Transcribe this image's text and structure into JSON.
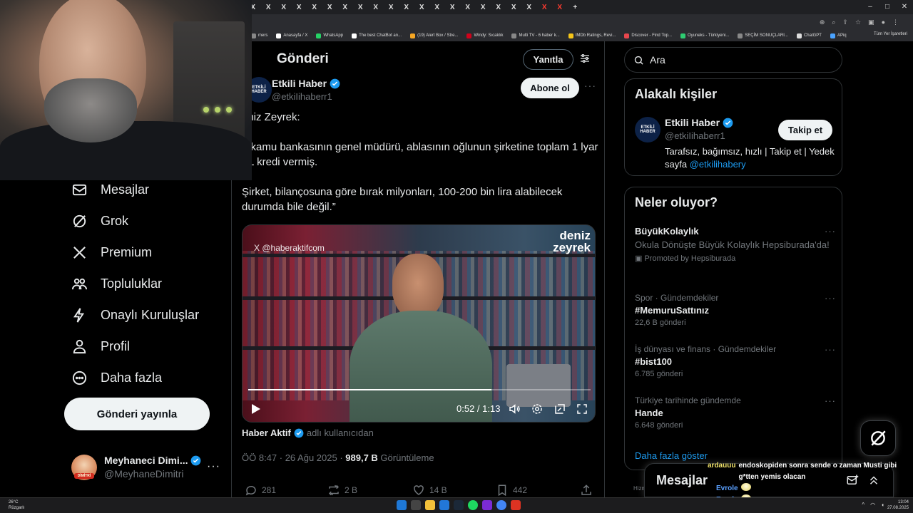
{
  "browser": {
    "bookmarks": [
      "mers",
      "Anasayfa / X",
      "WhatsApp",
      "The best ChatBot an...",
      "(19) Alert Box / Stre...",
      "Windy: Sıcaklık",
      "Multi TV - 6 haber k...",
      "IMDb Ratings, Revi...",
      "Discover - Find Top...",
      "Oyuneks - Türkiyeni...",
      "SEÇİM SONUÇLARI...",
      "ChatGPT",
      "APiq"
    ],
    "bookmarks_right": "Tüm Yer İşaretleri"
  },
  "nav": {
    "items": [
      {
        "label": "Mesajlar",
        "icon": "mail-icon"
      },
      {
        "label": "Grok",
        "icon": "grok-icon"
      },
      {
        "label": "Premium",
        "icon": "x-logo-icon"
      },
      {
        "label": "Topluluklar",
        "icon": "communities-icon"
      },
      {
        "label": "Onaylı Kuruluşlar",
        "icon": "lightning-icon"
      },
      {
        "label": "Profil",
        "icon": "person-icon"
      },
      {
        "label": "Daha fazla",
        "icon": "more-circle-icon"
      }
    ],
    "post_button": "Gönderi yayınla",
    "account": {
      "name": "Meyhaneci Dimi...",
      "handle": "@MeyhaneDimitri",
      "more": "···",
      "avatar_caption": "DİMİTRİ"
    }
  },
  "main": {
    "header_title": "Gönderi",
    "reply_button": "Yanıtla",
    "tweet": {
      "author_name": "Etkili Haber",
      "author_handle": "@etkiIihaberr1",
      "avatar_text": "ETKİLİ HABER",
      "follow_button": "Abone ol",
      "more": "···",
      "paragraphs": [
        "eniz Zeyrek:",
        "ir kamu bankasının genel müdürü, ablasının oğlunun şirketine toplam 1 lyar TL kredi vermiş.",
        "Şirket, bilançosuna göre bırak milyonları, 100-200 bin lira alabilecek durumda bile değil.”"
      ],
      "video": {
        "watermark": "X @haberaktifcom",
        "brand": "deniz zeyrek",
        "time": "0:52 / 1:13",
        "progress": 0.71
      },
      "source_name": "Haber Aktif",
      "source_suffix": "adlı kullanıcıdan",
      "timestamp": "ÖÖ 8:47 · 26 Ağu 2025 · ",
      "views": "989,7 B",
      "views_label": " Görüntüleme",
      "actions": {
        "replies": "281",
        "reposts": "2 B",
        "likes": "14 B",
        "bookmarks": "442"
      }
    }
  },
  "sidebar": {
    "search_placeholder": "Ara",
    "related": {
      "title": "Alakalı kişiler",
      "name": "Etkili Haber",
      "handle": "@etkiIihaberr1",
      "follow_button": "Takip et",
      "bio": "Tarafsız, bağımsız, hızlı | Takip et | Yedek sayfa ",
      "bio_link": "@etkilihabery"
    },
    "trends": {
      "title": "Neler oluyor?",
      "items": [
        {
          "category": "",
          "title": "BüyükKolaylık",
          "subtitle": "Okula Dönüşte Büyük Kolaylık Hepsiburada'da!",
          "count": "Promoted by Hepsiburada"
        },
        {
          "category": "Spor · Gündemdekiler",
          "title": "#MemuruSattınız",
          "subtitle": "",
          "count": "22,6 B gönderi"
        },
        {
          "category": "İş dünyası ve finans · Gündemdekiler",
          "title": "#bist100",
          "subtitle": "",
          "count": "6.785 gönderi"
        },
        {
          "category": "Türkiye tarihinde gündemde",
          "title": "Hande",
          "subtitle": "",
          "count": "6.648 gönderi"
        }
      ],
      "show_more": "Daha fazla göster"
    },
    "footer_text": "Hizm"
  },
  "dm_drawer": {
    "title": "Mesajlar"
  },
  "chat": [
    {
      "user": "ardauuu",
      "message": "endoskopiden sonra sende o zaman Musti gibi g*tten yemis olacan"
    },
    {
      "user": "Evrole",
      "message": ""
    },
    {
      "user": "Evrole",
      "message": ""
    }
  ],
  "taskbar": {
    "temp": "26°C",
    "weather": "Rüzgarlı",
    "time": "13:04",
    "date": "27.08.2025"
  },
  "colors": {
    "accent": "#1d9bf0",
    "background": "#000000",
    "text": "#e7e9ea",
    "muted": "#71767b",
    "border": "#2f3336"
  }
}
